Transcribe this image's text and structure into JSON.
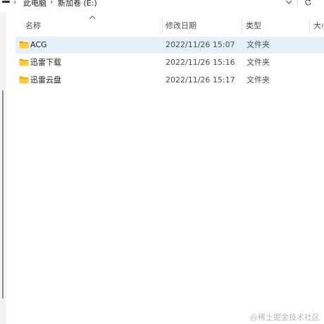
{
  "address_bar": {
    "segments": [
      "此电脑",
      "新加卷 (E:)"
    ],
    "separator": "›",
    "chevron_icon": "chevron-down-icon",
    "refresh_icon": "refresh-icon"
  },
  "columns": {
    "name": "名称",
    "modified": "修改日期",
    "type": "类型",
    "size": "大小"
  },
  "sort": {
    "column": "name",
    "direction": "ascending"
  },
  "files": [
    {
      "name": "ACG",
      "modified": "2022/11/26 15:07",
      "type": "文件夹",
      "icon": "folder-icon",
      "selected": true
    },
    {
      "name": "迅雷下载",
      "modified": "2022/11/26 15:16",
      "type": "文件夹",
      "icon": "folder-icon",
      "selected": false
    },
    {
      "name": "迅雷云盘",
      "modified": "2022/11/26 15:17",
      "type": "文件夹",
      "icon": "folder-icon",
      "selected": false
    }
  ],
  "watermark": "@稀土掘金技术社区",
  "colors": {
    "selection": "#e5f0fb",
    "folder_body": "#ffc83d",
    "folder_tab": "#e8a800",
    "nav_background": "#f3f3f3"
  }
}
